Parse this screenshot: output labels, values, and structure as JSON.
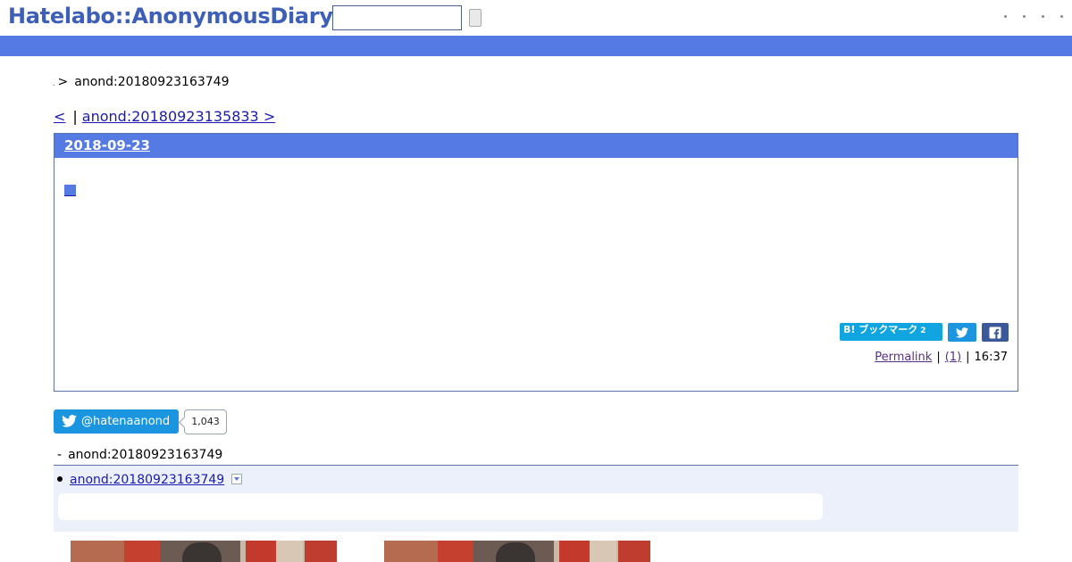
{
  "header": {
    "logo": "Hatelabo::AnonymousDiary",
    "search": {
      "value": "",
      "placeholder": ""
    }
  },
  "breadcrumb": {
    "separator": ">",
    "current": "anond:20180923163749"
  },
  "pager": {
    "prev_label": "<",
    "divider": "|",
    "next_label": "anond:20180923135833 >"
  },
  "entry": {
    "date": "2018-09-23",
    "bookmark": {
      "label": "B! ブックマーク",
      "count": "2"
    },
    "meta": {
      "permalink_label": "Permalink",
      "divider": "|",
      "comments_label": "(1)",
      "time": "16:37"
    }
  },
  "follow": {
    "label": "@hatenaanond",
    "count": "1,043"
  },
  "references": {
    "title_prefix": "-",
    "title": "anond:20180923163749",
    "items": [
      {
        "label": "anond:20180923163749"
      }
    ]
  },
  "colors": {
    "accent": "#557ae3",
    "logo": "#3d5fb8",
    "link": "#1a1ab0",
    "visited": "#5a2f8c",
    "twitter": "#1b95e0",
    "facebook": "#3b5998",
    "hatebu": "#10a4e0",
    "ref_background": "#ebf0fb"
  },
  "icons": [
    "twitter-icon",
    "facebook-icon",
    "square-section-icon",
    "dropdown-toggle-icon"
  ]
}
